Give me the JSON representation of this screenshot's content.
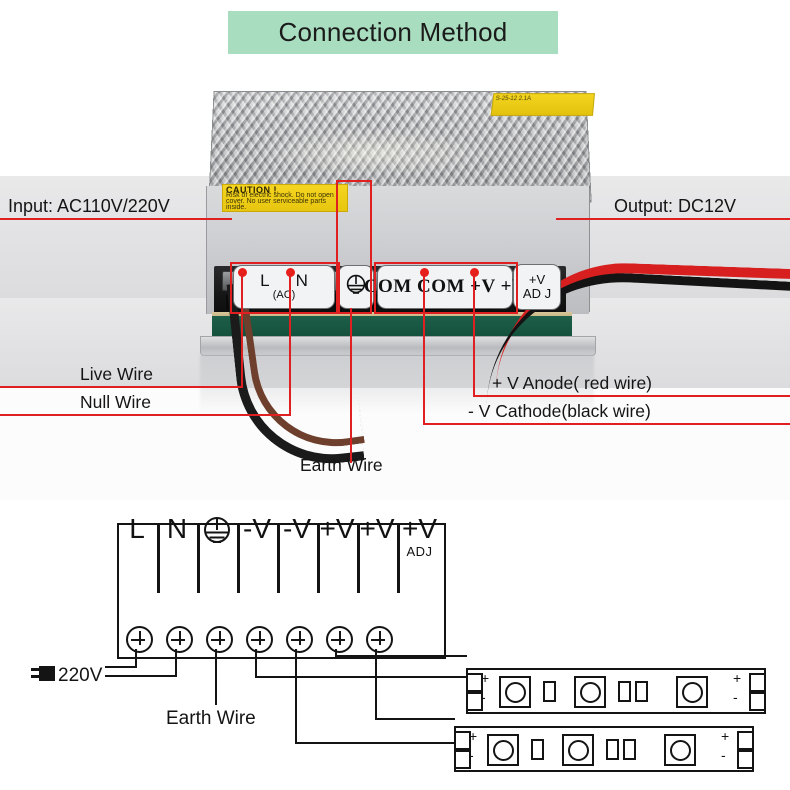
{
  "title": {
    "text": "Connection Method",
    "banner_color": "#a8ddbf"
  },
  "photo": {
    "labels": {
      "input": "Input: AC110V/220V",
      "output": "Output: DC12V",
      "live_wire": "Live Wire",
      "null_wire": "Null Wire",
      "earth_wire": "Earth Wire",
      "anode": "+ V  Anode( red wire)",
      "cathode": "- V   Cathode(black wire)"
    },
    "terminal_callouts": {
      "ln_top": "L  N",
      "ln_sub": "(AC)",
      "ground_icon": "earth-ground-symbol",
      "com": "COM COM  +V   +V",
      "adj_top": "+V",
      "adj_bottom": "AD J"
    },
    "case_labels": {
      "caution_title": "CAUTION !",
      "caution_body": "Risk of electric shock. Do not open cover. No user serviceable parts inside.",
      "spec_label": "S-25-12   2.1A"
    },
    "annotation_color": "#e02020"
  },
  "diagram": {
    "terminal_block": {
      "cells": [
        {
          "label": "L",
          "sub": ""
        },
        {
          "label": "N",
          "sub": ""
        },
        {
          "label": "",
          "sub": "",
          "icon": "earth-ground-symbol"
        },
        {
          "label": "-V",
          "sub": ""
        },
        {
          "label": "-V",
          "sub": ""
        },
        {
          "label": "+V",
          "sub": ""
        },
        {
          "label": "+V",
          "sub": ""
        },
        {
          "label": "+V",
          "sub": "ADJ"
        }
      ],
      "screw_count": 7
    },
    "mains_label": "220V",
    "mains_icon": "ac-plug-icon",
    "earth_label": "Earth Wire",
    "led_strips": [
      {
        "name": "led-strip-1",
        "left_plus": "+",
        "left_minus": "-",
        "right_plus": "+",
        "right_minus": "-"
      },
      {
        "name": "led-strip-2",
        "left_plus": "+",
        "left_minus": "-",
        "right_plus": "+",
        "right_minus": "-"
      }
    ]
  }
}
